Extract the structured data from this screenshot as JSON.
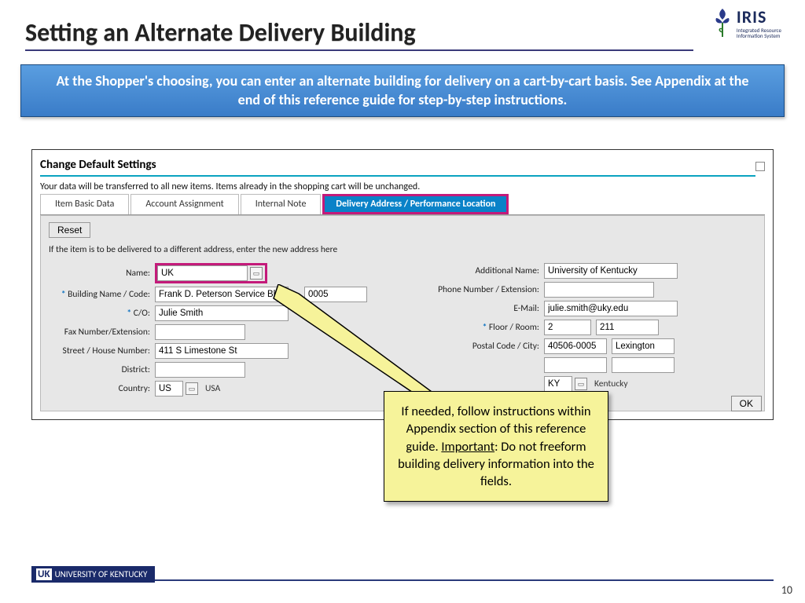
{
  "title": "Setting an Alternate Delivery Building",
  "logo": {
    "brand": "IRIS",
    "sub1": "Integrated Resource",
    "sub2": "Information System"
  },
  "banner": "At the Shopper's choosing, you can enter an alternate building for delivery on a cart-by-cart basis. See Appendix at the end of this reference guide for step-by-step instructions.",
  "window": {
    "title": "Change Default Settings",
    "note": "Your data will be transferred to all new items. Items already in the shopping cart will be unchanged.",
    "tabs": [
      "Item Basic Data",
      "Account Assignment",
      "Internal Note",
      "Delivery Address / Performance Location"
    ],
    "active_tab": 3,
    "reset": "Reset",
    "sub_note": "If the item is to be delivered to a different address, enter the new address here",
    "ok": "OK"
  },
  "left_fields": {
    "name_label": "Name:",
    "name_value": "UK",
    "building_label": "Building Name / Code:",
    "building_value": "Frank D. Peterson Service Bldg",
    "building_code": "0005",
    "co_label": "C/O:",
    "co_value": "Julie Smith",
    "fax_label": "Fax Number/Extension:",
    "fax_value": "",
    "street_label": "Street / House Number:",
    "street_value": "411 S Limestone St",
    "district_label": "District:",
    "district_value": "",
    "country_label": "Country:",
    "country_value": "US",
    "country_name": "USA"
  },
  "right_fields": {
    "add_name_label": "Additional Name:",
    "add_name_value": "University of Kentucky",
    "phone_label": "Phone Number / Extension:",
    "phone_value": "",
    "email_label": "E-Mail:",
    "email_value": "julie.smith@uky.edu",
    "floor_label": "Floor / Room:",
    "floor_value": "2",
    "room_value": "211",
    "postal_label": "Postal Code / City:",
    "postal_value": "40506-0005",
    "city_value": "Lexington",
    "region_value": "KY",
    "region_name": "Kentucky"
  },
  "callout": {
    "line1": "If needed, follow instructions within Appendix section of this reference guide. ",
    "important": "Important",
    "line2": ": Do not freeform building delivery information into the fields."
  },
  "footer": {
    "org": "UNIVERSITY OF KENTUCKY",
    "uk": "UK"
  },
  "page": "10"
}
